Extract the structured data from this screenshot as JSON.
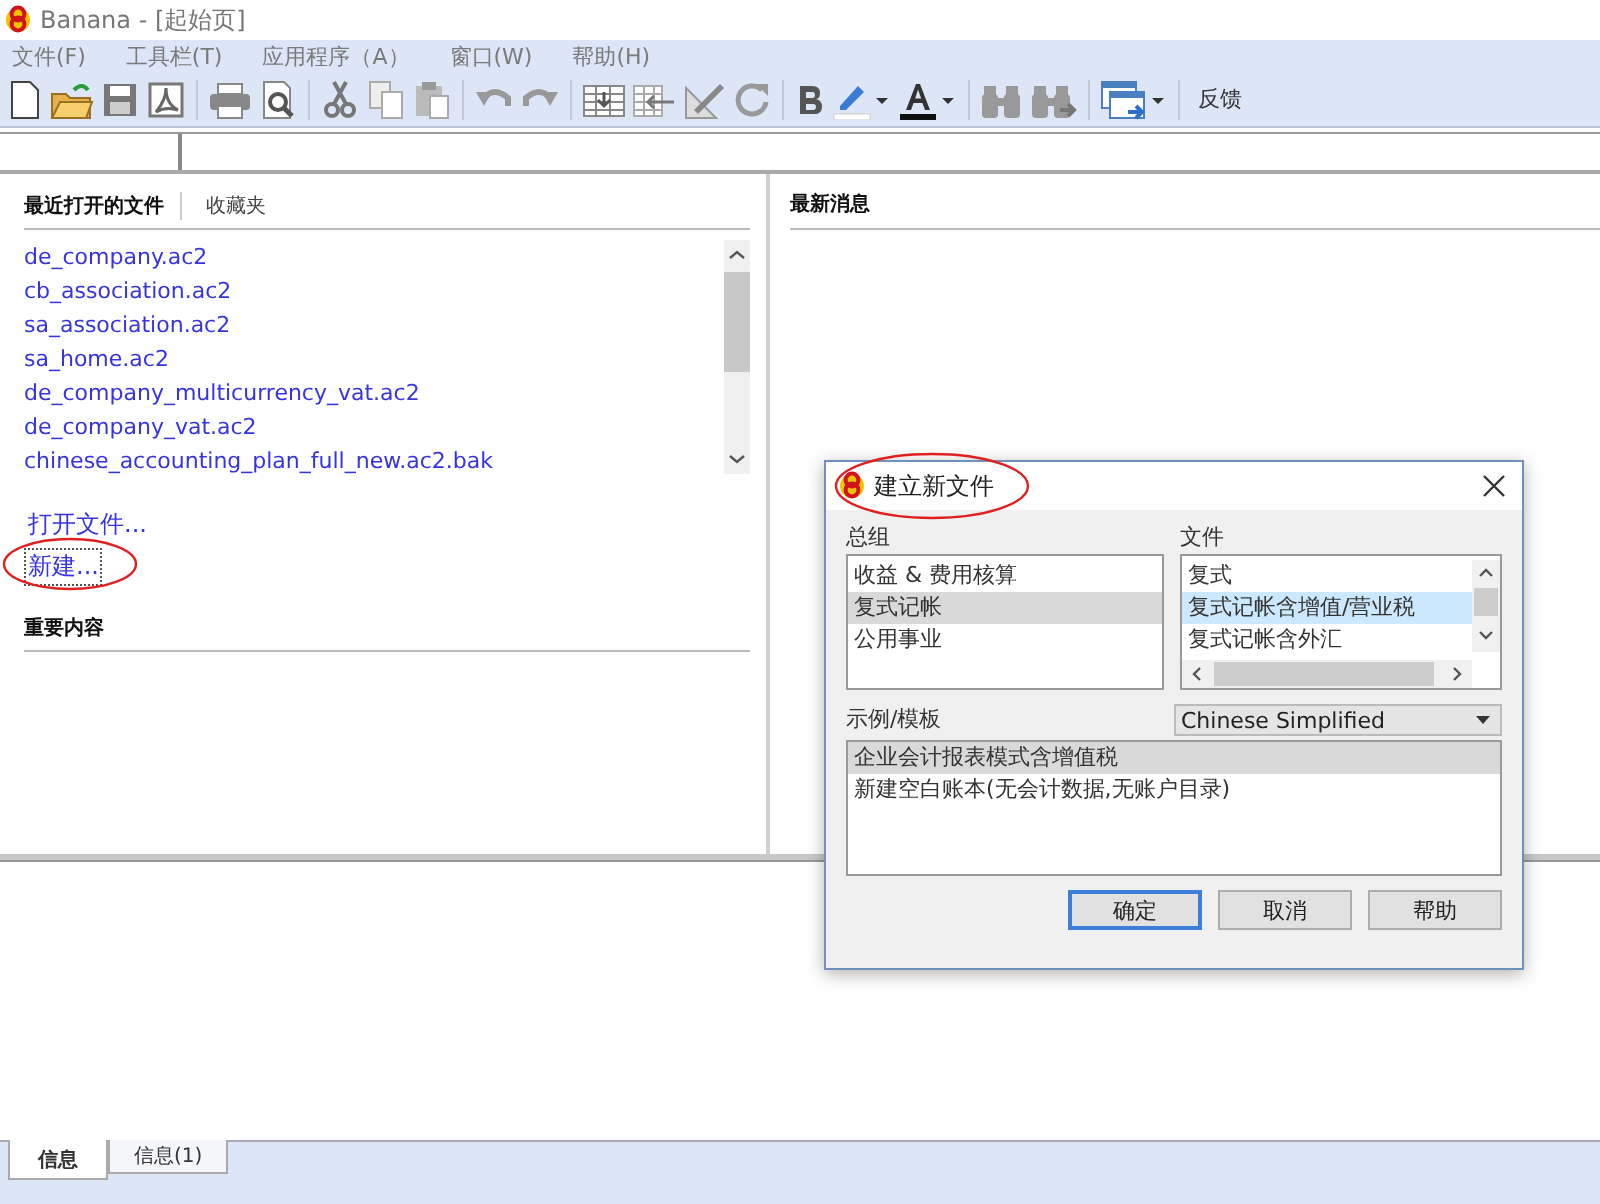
{
  "window": {
    "title": "Banana - [起始页]"
  },
  "menu": [
    "文件(F)",
    "工具栏(T)",
    "应用程序（A）",
    "窗口(W)",
    "帮助(H)"
  ],
  "toolbar": {
    "feedback": "反馈"
  },
  "start_page": {
    "tabs": [
      {
        "label": "最近打开的文件",
        "selected": true
      },
      {
        "label": "收藏夹",
        "selected": false
      }
    ],
    "recent_files": [
      "de_company.ac2",
      "cb_association.ac2",
      "sa_association.ac2",
      "sa_home.ac2",
      "de_company_multicurrency_vat.ac2",
      "de_company_vat.ac2",
      "chinese_accounting_plan_full_new.ac2.bak"
    ],
    "links": [
      {
        "label": "打开文件...",
        "focused": false
      },
      {
        "label": "新建...",
        "focused": true
      }
    ],
    "important_heading": "重要内容",
    "news_heading": "最新消息"
  },
  "dialog": {
    "title": "建立新文件",
    "group_label": "总组",
    "groups": [
      {
        "label": "收益 & 费用核算",
        "selected": false
      },
      {
        "label": "复式记帐",
        "selected": true
      },
      {
        "label": "公用事业",
        "selected": false
      }
    ],
    "file_label": "文件",
    "files": [
      {
        "label": "复式",
        "selected": false
      },
      {
        "label": "复式记帐含增值/营业税",
        "selected": true
      },
      {
        "label": "复式记帐含外汇",
        "selected": false
      }
    ],
    "template_label": "示例/模板",
    "language": "Chinese Simplified",
    "templates": [
      {
        "label": "企业会计报表模式含增值税",
        "selected": true
      },
      {
        "label": "新建空白账本(无会计数据,无账户目录)",
        "selected": false
      }
    ],
    "buttons": [
      {
        "label": "确定",
        "default": true
      },
      {
        "label": "取消",
        "default": false
      },
      {
        "label": "帮助",
        "default": false
      }
    ]
  },
  "info_tabs": [
    {
      "label": "信息",
      "selected": true
    },
    {
      "label": "信息(1)",
      "selected": false
    }
  ]
}
